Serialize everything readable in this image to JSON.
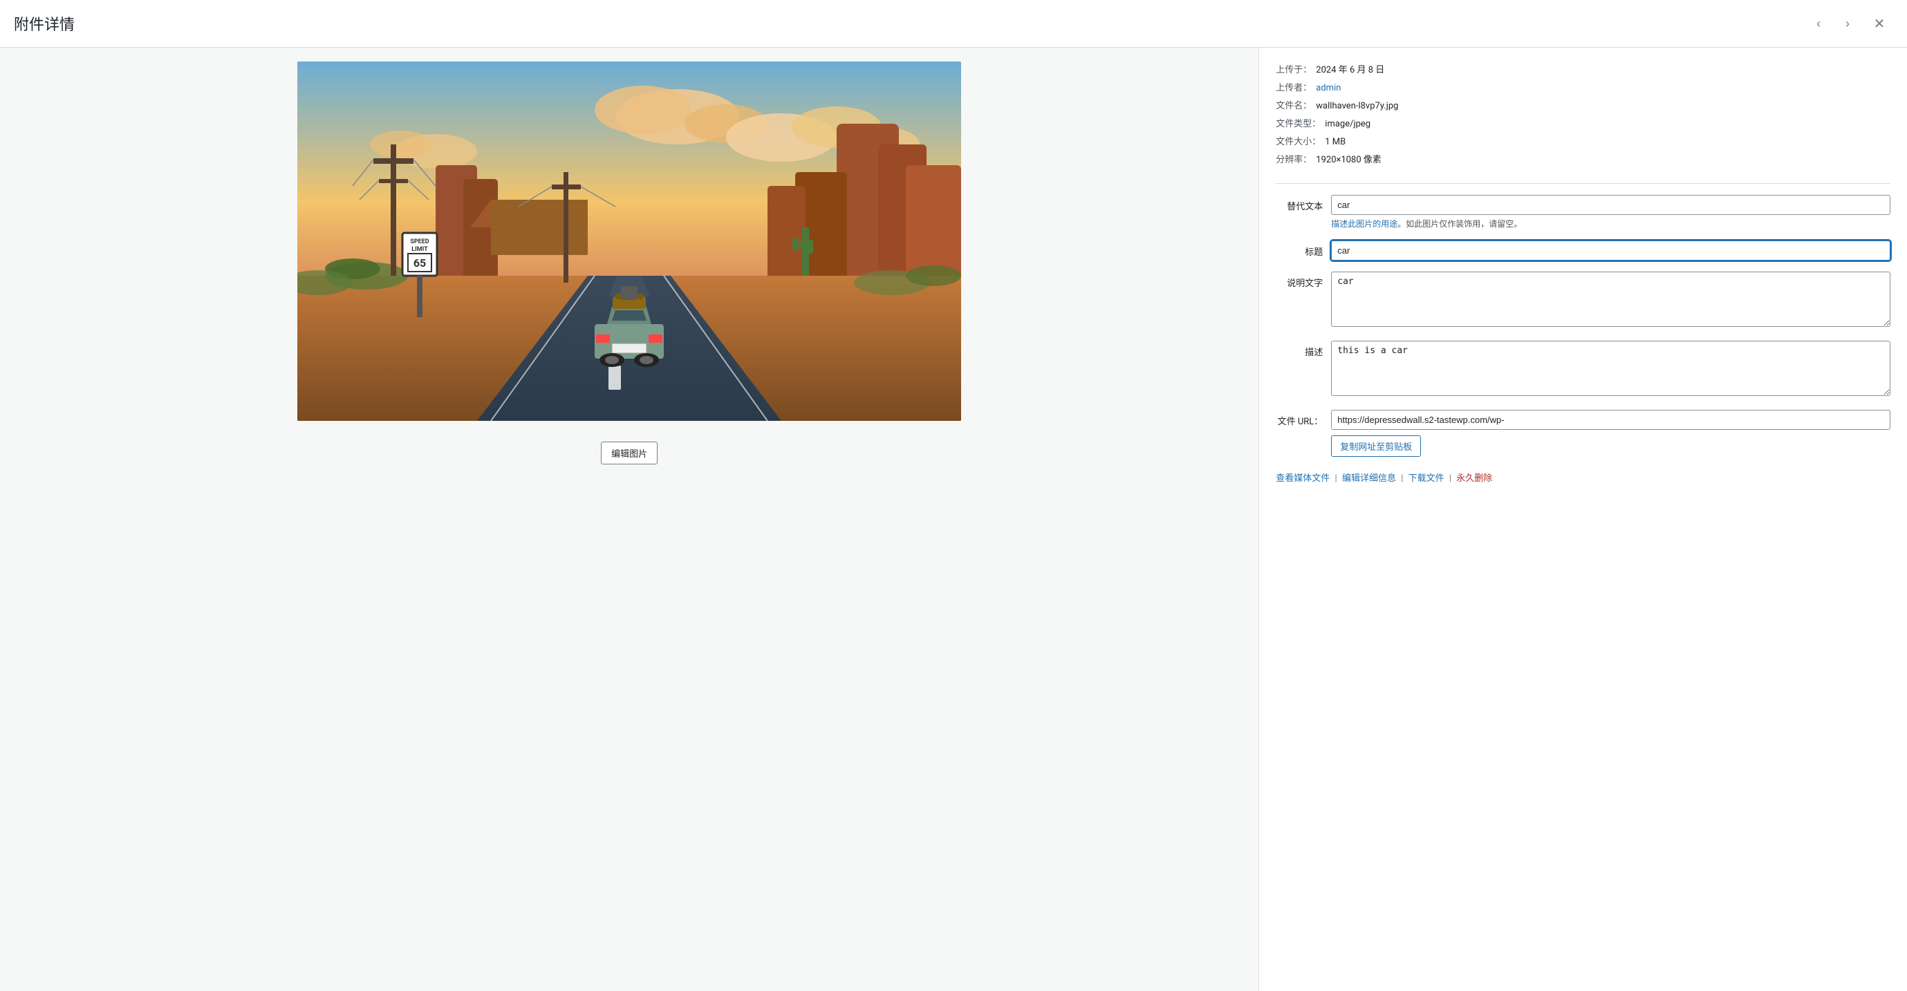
{
  "header": {
    "title": "附件详情",
    "prev_label": "‹",
    "next_label": "›",
    "close_label": "✕"
  },
  "meta": {
    "upload_date_label": "上传于：",
    "upload_date_value": "2024 年 6 月 8 日",
    "uploader_label": "上传者：",
    "uploader_value": "admin",
    "filename_label": "文件名：",
    "filename_value": "wallhaven-l8vp7y.jpg",
    "filetype_label": "文件类型：",
    "filetype_value": "image/jpeg",
    "filesize_label": "文件大小：",
    "filesize_value": "1 MB",
    "resolution_label": "分辨率：",
    "resolution_value": "1920×1080 像素"
  },
  "form": {
    "alt_label": "替代文本",
    "alt_value": "car",
    "alt_hint_link": "描述此图片的用途",
    "alt_hint_text": "。如此图片仅作装饰用，请留空。",
    "title_label": "标题",
    "title_value": "car",
    "caption_label": "说明文字",
    "caption_value": "car",
    "description_label": "描述",
    "description_value": "this is a car",
    "url_label": "文件 URL：",
    "url_value": "https://depressedwall.s2-tastewp.com/wp-",
    "copy_btn_label": "复制网址至剪贴板"
  },
  "actions": {
    "view_label": "查看媒体文件",
    "edit_label": "编辑详细信息",
    "download_label": "下载文件",
    "delete_label": "永久删除"
  },
  "image": {
    "edit_btn_label": "编辑图片",
    "alt": "Desert road with car"
  }
}
